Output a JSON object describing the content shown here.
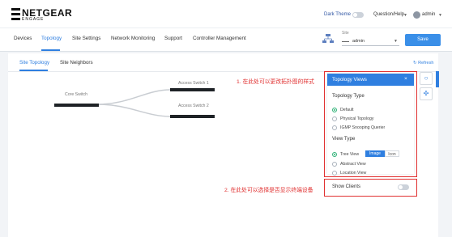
{
  "header": {
    "logo_main": "NETGEAR",
    "logo_sub": "ENGAGE",
    "dark_theme_label": "Dark Theme",
    "question_help_label": "Question/Help",
    "user_label": "admin"
  },
  "nav": {
    "tabs": [
      {
        "label": "Devices"
      },
      {
        "label": "Topology"
      },
      {
        "label": "Site Settings"
      },
      {
        "label": "Network Monitoring"
      },
      {
        "label": "Support"
      },
      {
        "label": "Controller Management"
      }
    ],
    "site_label": "Site",
    "site_value": "admin",
    "save_label": "Save"
  },
  "subtabs": [
    {
      "label": "Site Topology"
    },
    {
      "label": "Site Neighbors"
    }
  ],
  "refresh_label": "Refresh",
  "topology": {
    "core": "Core Switch",
    "access1": "Access Switch 1",
    "access2": "Access Switch 2"
  },
  "topology_views": {
    "title": "Topology Views",
    "close": "×",
    "type_label": "Topology Type",
    "type_options": [
      {
        "label": "Default",
        "selected": true
      },
      {
        "label": "Physical Topology",
        "selected": false
      },
      {
        "label": "IGMP Snooping Querier",
        "selected": false
      }
    ],
    "view_label": "View Type",
    "view_options": [
      {
        "label": "Tree View",
        "selected": true
      },
      {
        "label": "Abstract View",
        "selected": false
      },
      {
        "label": "Location View",
        "selected": false
      }
    ],
    "image_label": "Image",
    "icon_label": "Icon"
  },
  "show_clients_label": "Show Clients",
  "annotations": {
    "a1": "1. 在此处可以更改拓扑图的样式",
    "a2": "2. 在此处可以选择是否显示终端设备"
  },
  "colors": {
    "accent": "#2f7fe0",
    "annotation_red": "#e03030",
    "radio_selected": "#34b37a"
  }
}
